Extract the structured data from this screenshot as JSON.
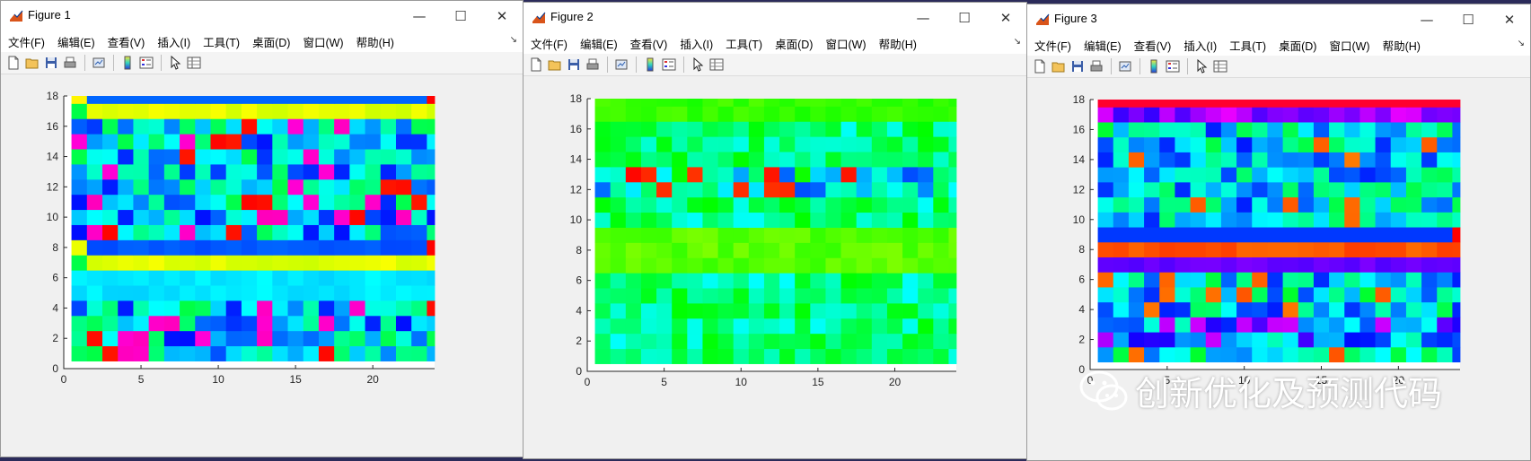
{
  "windows": [
    {
      "title": "Figure 1",
      "menu": [
        "文件(F)",
        "编辑(E)",
        "查看(V)",
        "插入(I)",
        "工具(T)",
        "桌面(D)",
        "窗口(W)",
        "帮助(H)"
      ],
      "controls": {
        "minimize": "—",
        "maximize": "☐",
        "close": "✕"
      },
      "axes": {
        "x_ticks": [
          "0",
          "5",
          "10",
          "15",
          "20"
        ],
        "y_ticks": [
          "0",
          "2",
          "4",
          "6",
          "8",
          "10",
          "12",
          "14",
          "16",
          "18"
        ]
      }
    },
    {
      "title": "Figure 2",
      "menu": [
        "文件(F)",
        "编辑(E)",
        "查看(V)",
        "插入(I)",
        "工具(T)",
        "桌面(D)",
        "窗口(W)",
        "帮助(H)"
      ],
      "controls": {
        "minimize": "—",
        "maximize": "☐",
        "close": "✕"
      },
      "axes": {
        "x_ticks": [
          "0",
          "5",
          "10",
          "15",
          "20"
        ],
        "y_ticks": [
          "0",
          "2",
          "4",
          "6",
          "8",
          "10",
          "12",
          "14",
          "16",
          "18"
        ]
      }
    },
    {
      "title": "Figure 3",
      "menu": [
        "文件(F)",
        "编辑(E)",
        "查看(V)",
        "插入(I)",
        "工具(T)",
        "桌面(D)",
        "窗口(W)",
        "帮助(H)"
      ],
      "controls": {
        "minimize": "—",
        "maximize": "☐",
        "close": "✕"
      },
      "axes": {
        "x_ticks": [
          "0",
          "5",
          "10",
          "15",
          "20"
        ],
        "y_ticks": [
          "0",
          "2",
          "4",
          "6",
          "8",
          "10",
          "12",
          "14",
          "16",
          "18"
        ]
      }
    }
  ],
  "toolbar_icons": [
    "new-figure-icon",
    "open-file-icon",
    "save-icon",
    "print-icon",
    "link-plot-icon",
    "colorbar-icon",
    "legend-icon",
    "pointer-icon",
    "property-inspector-icon"
  ],
  "watermark": {
    "text": "创新优化及预测代码"
  },
  "chart_data": [
    {
      "type": "heatmap",
      "x_range": [
        0,
        24
      ],
      "y_range": [
        0,
        18
      ],
      "rows": 18,
      "cols": 24,
      "colormap": "hsv"
    },
    {
      "type": "heatmap",
      "x_range": [
        0,
        24
      ],
      "y_range": [
        0,
        18
      ],
      "rows": 18,
      "cols": 24,
      "colormap": "hsv"
    },
    {
      "type": "heatmap",
      "x_range": [
        0,
        24
      ],
      "y_range": [
        0,
        18
      ],
      "rows": 18,
      "cols": 24,
      "colormap": "hsv"
    }
  ]
}
